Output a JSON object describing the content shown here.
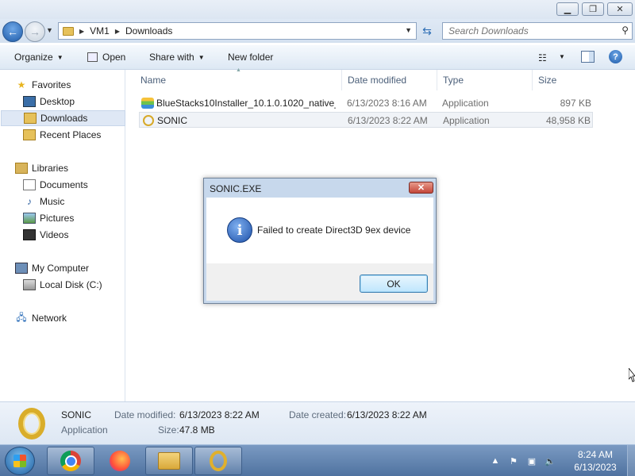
{
  "window": {
    "minimize_glyph": "▁",
    "maximize_glyph": "❐",
    "close_glyph": "✕"
  },
  "address": {
    "crumbs": [
      "VM1",
      "Downloads"
    ],
    "separator": "▶",
    "search_placeholder": "Search Downloads"
  },
  "toolbar": {
    "organize": "Organize",
    "open": "Open",
    "share_with": "Share with",
    "new_folder": "New folder"
  },
  "nav": {
    "favorites": "Favorites",
    "desktop": "Desktop",
    "downloads": "Downloads",
    "recent_places": "Recent Places",
    "libraries": "Libraries",
    "documents": "Documents",
    "music": "Music",
    "pictures": "Pictures",
    "videos": "Videos",
    "my_computer": "My Computer",
    "local_disk": "Local Disk (C:)",
    "network": "Network"
  },
  "columns": {
    "name": "Name",
    "date_modified": "Date modified",
    "type": "Type",
    "size": "Size"
  },
  "files": [
    {
      "name": "BlueStacks10Installer_10.1.0.1020_native_...",
      "date": "6/13/2023 8:16 AM",
      "type": "Application",
      "size": "897 KB",
      "icon": "bluestacks-icon"
    },
    {
      "name": "SONIC",
      "date": "6/13/2023 8:22 AM",
      "type": "Application",
      "size": "48,958 KB",
      "icon": "sonic-ring-icon"
    }
  ],
  "details": {
    "name": "SONIC",
    "type": "Application",
    "date_modified_label": "Date modified:",
    "date_modified": "6/13/2023 8:22 AM",
    "date_created_label": "Date created:",
    "date_created": "6/13/2023 8:22 AM",
    "size_label": "Size:",
    "size": "47.8 MB"
  },
  "dialog": {
    "title": "SONIC.EXE",
    "message": "Failed to create Direct3D 9ex device",
    "ok": "OK",
    "icon": "information-icon"
  },
  "taskbar": {
    "time": "8:24 AM",
    "date": "6/13/2023",
    "apps": [
      "chrome-icon",
      "firefox-icon",
      "explorer-icon",
      "sonic-ring-icon"
    ]
  },
  "colors": {
    "accent": "#1d5aa8",
    "selection": "#dfe8f5",
    "taskbar": "#5f82ad"
  }
}
